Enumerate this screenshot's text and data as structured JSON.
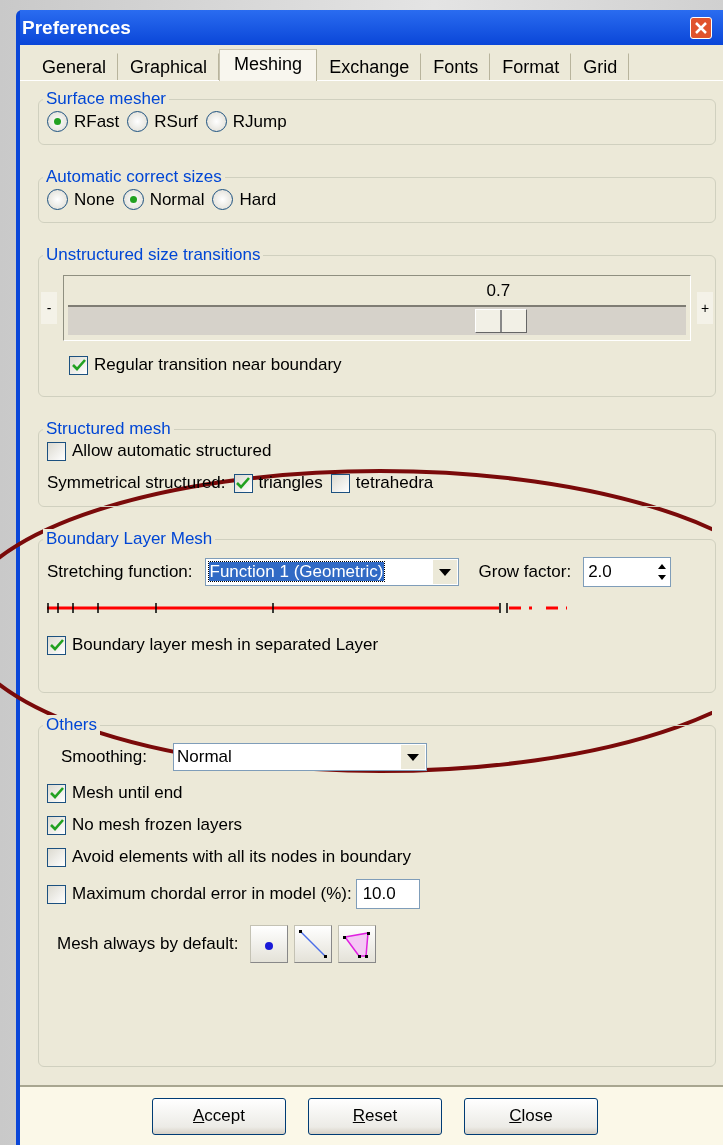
{
  "window": {
    "title": "Preferences"
  },
  "tabs": [
    {
      "label": "General",
      "selected": false
    },
    {
      "label": "Graphical",
      "selected": false
    },
    {
      "label": "Meshing",
      "selected": true
    },
    {
      "label": "Exchange",
      "selected": false
    },
    {
      "label": "Fonts",
      "selected": false
    },
    {
      "label": "Format",
      "selected": false
    },
    {
      "label": "Grid",
      "selected": false
    }
  ],
  "surface_mesher": {
    "title": "Surface mesher",
    "options": [
      {
        "label": "RFast",
        "selected": true
      },
      {
        "label": "RSurf",
        "selected": false
      },
      {
        "label": "RJump",
        "selected": false
      }
    ]
  },
  "automatic_correct_sizes": {
    "title": "Automatic correct sizes",
    "options": [
      {
        "label": "None",
        "selected": false
      },
      {
        "label": "Normal",
        "selected": true
      },
      {
        "label": "Hard",
        "selected": false
      }
    ]
  },
  "unstructured_size_transitions": {
    "title": "Unstructured size transitions",
    "minus": "-",
    "plus": "+",
    "reading": "0.7",
    "level": 0.7,
    "regular_transition": {
      "label": "Regular transition near boundary",
      "checked": true
    }
  },
  "structured_mesh": {
    "title": "Structured mesh",
    "allow_automatic": {
      "label": "Allow automatic structured",
      "checked": false
    },
    "symmetrical_label": "Symmetrical structured:",
    "symmetrical": [
      {
        "label": "triangles",
        "checked": true
      },
      {
        "label": "tetrahedra",
        "checked": false
      }
    ]
  },
  "boundary_layer_mesh": {
    "title": "Boundary Layer Mesh",
    "stretching_label": "Stretching function:",
    "stretching_value": "Function 1 (Geometric)",
    "grow_label": "Grow factor:",
    "grow_value": "2.0",
    "separated_layer": {
      "label": "Boundary layer mesh in separated Layer",
      "checked": true
    }
  },
  "others": {
    "title": "Others",
    "smoothing_label": "Smoothing:",
    "smoothing_value": "Normal",
    "checks": [
      {
        "label": "Mesh until end",
        "checked": true
      },
      {
        "label": "No mesh frozen layers",
        "checked": true
      },
      {
        "label": "Avoid elements with all its nodes in boundary",
        "checked": false
      }
    ],
    "chordal": {
      "label": "Maximum chordal error in model (%):",
      "checked": false,
      "value": "10.0"
    },
    "mesh_default_label": "Mesh always by default:",
    "mesh_default_buttons": [
      {
        "kind": "point"
      },
      {
        "kind": "line"
      },
      {
        "kind": "surface"
      }
    ]
  },
  "buttons": [
    {
      "mnemonic": "A",
      "rest": "ccept"
    },
    {
      "mnemonic": "R",
      "rest": "eset"
    },
    {
      "mnemonic": "C",
      "rest": "lose"
    }
  ],
  "annotation": {
    "kind": "ellipse"
  }
}
